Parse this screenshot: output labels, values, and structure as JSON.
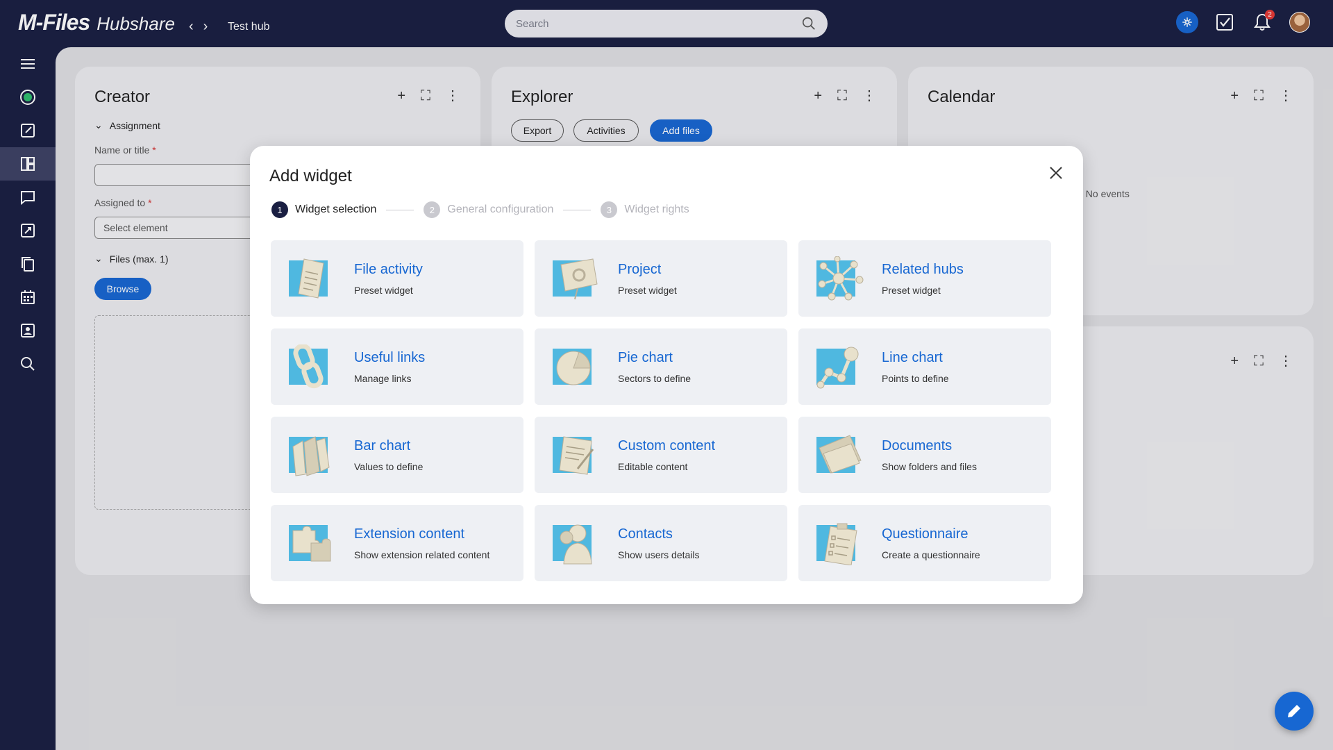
{
  "app": {
    "logo_main": "M-Files",
    "logo_sub": "Hubshare",
    "hub_title": "Test hub"
  },
  "search": {
    "placeholder": "Search"
  },
  "notifications": {
    "count": "2"
  },
  "cards": {
    "creator": {
      "title": "Creator",
      "assignment_label": "Assignment",
      "name_label": "Name or title",
      "assigned_label": "Assigned to",
      "assigned_placeholder": "Select element",
      "files_label": "Files (max. 1)",
      "browse_label": "Browse",
      "required_mark": "*"
    },
    "explorer": {
      "title": "Explorer",
      "export_label": "Export",
      "activities_label": "Activities",
      "add_files_label": "Add files"
    },
    "calendar": {
      "title": "Calendar",
      "no_events": "No events"
    }
  },
  "modal": {
    "title": "Add widget",
    "steps": [
      {
        "num": "1",
        "label": "Widget selection"
      },
      {
        "num": "2",
        "label": "General configuration"
      },
      {
        "num": "3",
        "label": "Widget rights"
      }
    ],
    "widgets": [
      {
        "title": "File activity",
        "subtitle": "Preset widget",
        "icon": "file-activity-icon"
      },
      {
        "title": "Project",
        "subtitle": "Preset widget",
        "icon": "project-icon"
      },
      {
        "title": "Related hubs",
        "subtitle": "Preset widget",
        "icon": "related-hubs-icon"
      },
      {
        "title": "Useful links",
        "subtitle": "Manage links",
        "icon": "useful-links-icon"
      },
      {
        "title": "Pie chart",
        "subtitle": "Sectors to define",
        "icon": "pie-chart-icon"
      },
      {
        "title": "Line chart",
        "subtitle": "Points to define",
        "icon": "line-chart-icon"
      },
      {
        "title": "Bar chart",
        "subtitle": "Values to define",
        "icon": "bar-chart-icon"
      },
      {
        "title": "Custom content",
        "subtitle": "Editable content",
        "icon": "custom-content-icon"
      },
      {
        "title": "Documents",
        "subtitle": "Show folders and files",
        "icon": "documents-icon"
      },
      {
        "title": "Extension content",
        "subtitle": "Show extension related content",
        "icon": "extension-content-icon"
      },
      {
        "title": "Contacts",
        "subtitle": "Show users details",
        "icon": "contacts-icon"
      },
      {
        "title": "Questionnaire",
        "subtitle": "Create a questionnaire",
        "icon": "questionnaire-icon"
      }
    ]
  },
  "colors": {
    "brand_navy": "#1a1f42",
    "accent_blue": "#1767d2",
    "tile_icon_blue": "#4fb8e0",
    "tile_icon_paper": "#e8e1cc"
  }
}
